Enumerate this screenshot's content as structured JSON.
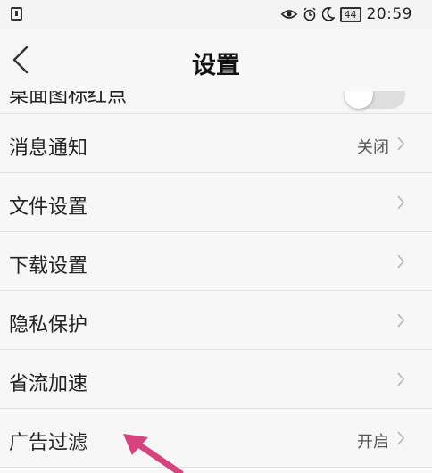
{
  "status_bar": {
    "battery": "44",
    "time": "20:59"
  },
  "header": {
    "title": "设置"
  },
  "partial_row": {
    "label": "桌面图标红点"
  },
  "settings": [
    {
      "label": "消息通知",
      "value": "关闭"
    },
    {
      "label": "文件设置",
      "value": ""
    },
    {
      "label": "下载设置",
      "value": ""
    },
    {
      "label": "隐私保护",
      "value": ""
    },
    {
      "label": "省流加速",
      "value": ""
    },
    {
      "label": "广告过滤",
      "value": "开启"
    }
  ],
  "colors": {
    "background": "#f7f7f7",
    "divider": "#e3e3e3",
    "annotation_arrow": "#d6437e"
  }
}
